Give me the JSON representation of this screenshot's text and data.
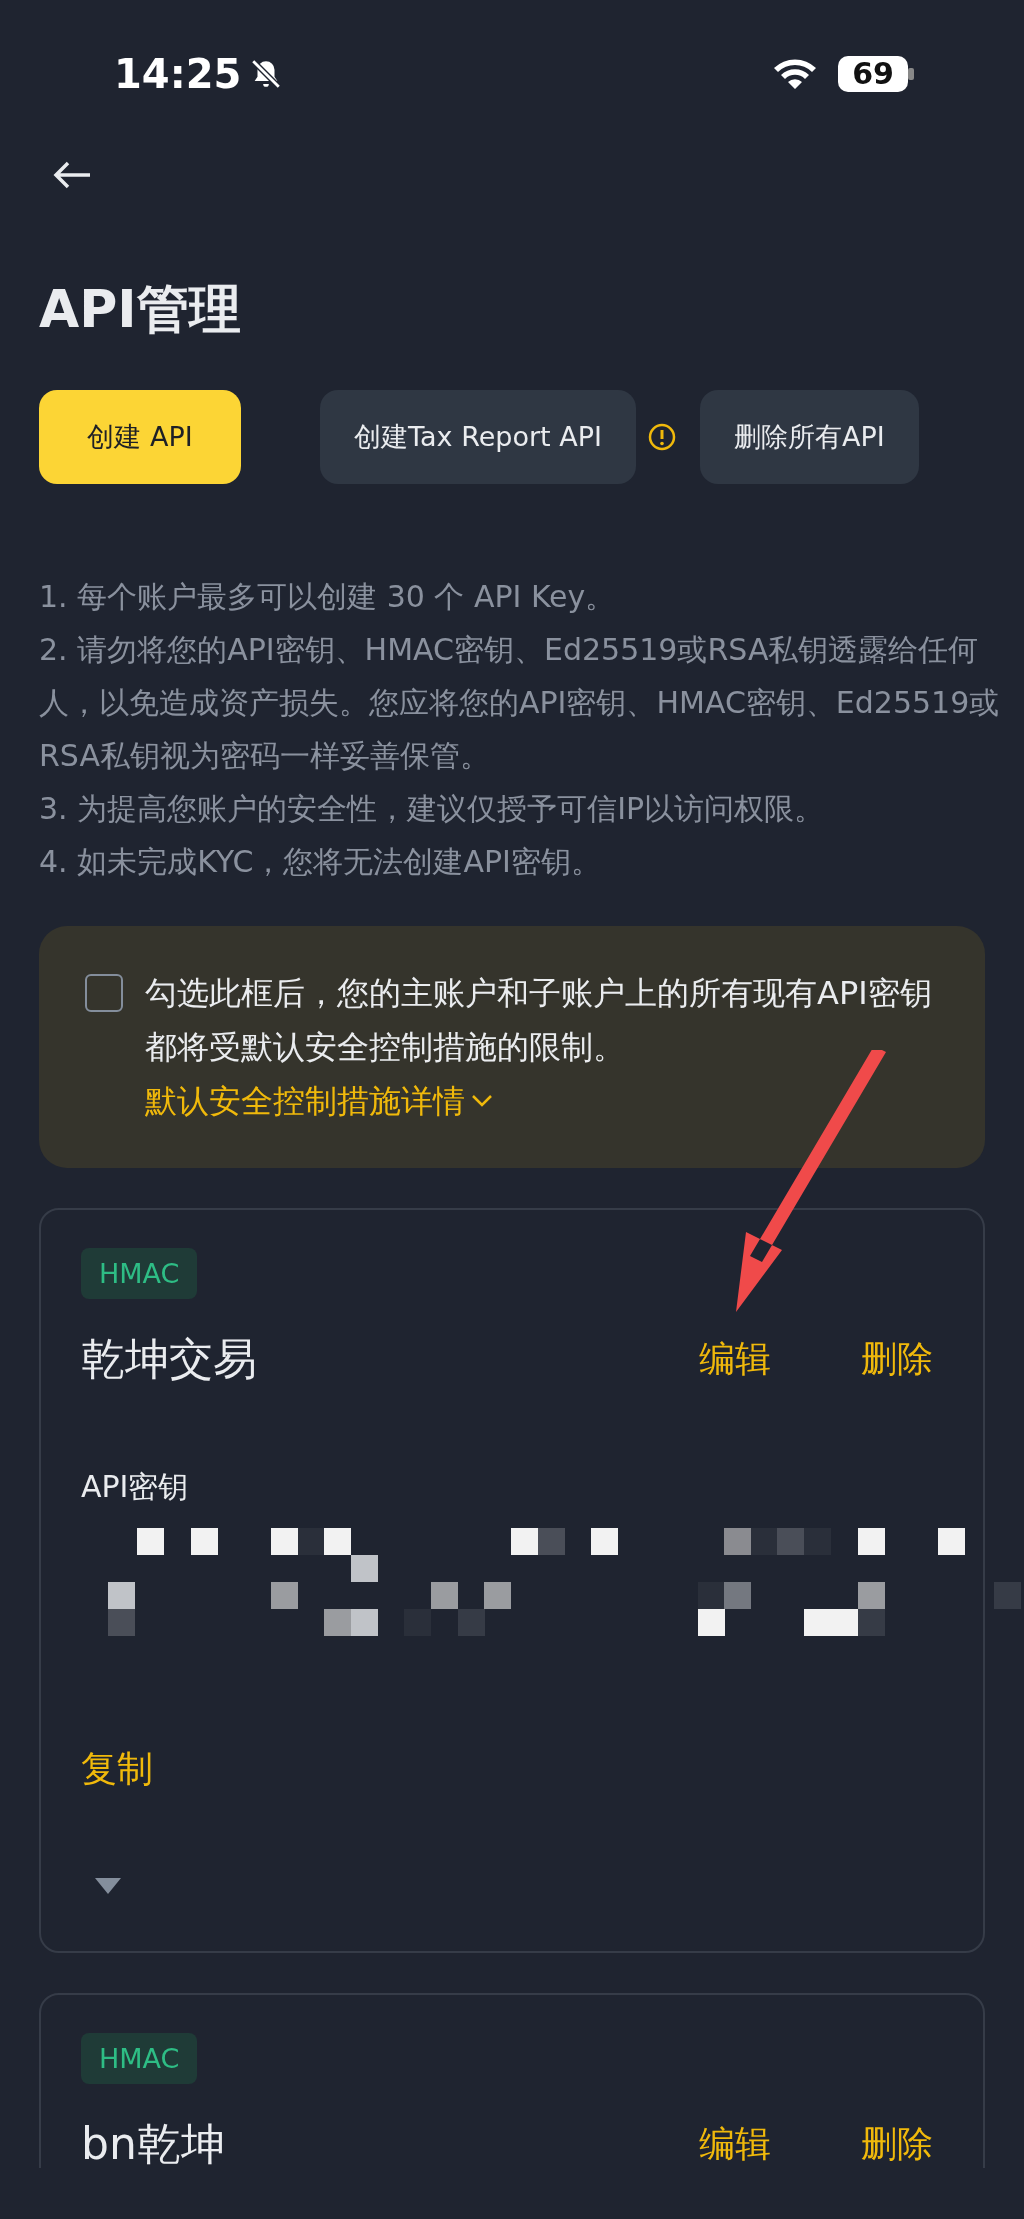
{
  "status_bar": {
    "time": "14:25",
    "battery": "69"
  },
  "title": "API管理",
  "actions": [
    {
      "label": "创建 API",
      "kind": "primary"
    },
    {
      "label": "创建Tax Report API",
      "kind": "secondary",
      "info": true
    },
    {
      "label": "删除所有API",
      "kind": "secondary",
      "info": false
    }
  ],
  "notes": [
    "1. 每个账户最多可以创建 30 个 API Key。",
    "2. 请勿将您的API密钥、HMAC密钥、Ed25519或RSA私钥透露给任何人，以免造成资产损失。您应将您的API密钥、HMAC密钥、Ed25519或RSA私钥视为密码一样妥善保管。",
    "3. 为提高您账户的安全性，建议仅授予可信IP以访问权限。",
    "4. 如未完成KYC，您将无法创建API密钥。"
  ],
  "notice": {
    "checked": false,
    "text": "勾选此框后，您的主账户和子账户上的所有现有API密钥都将受默认安全控制措施的限制。",
    "link": "默认安全控制措施详情"
  },
  "keys": [
    {
      "type": "HMAC",
      "name": "乾坤交易",
      "edit": "编辑",
      "delete": "删除",
      "key_label": "API密钥",
      "copy": "复制"
    },
    {
      "type": "HMAC",
      "name": "bn乾坤",
      "edit": "编辑",
      "delete": "删除"
    }
  ]
}
